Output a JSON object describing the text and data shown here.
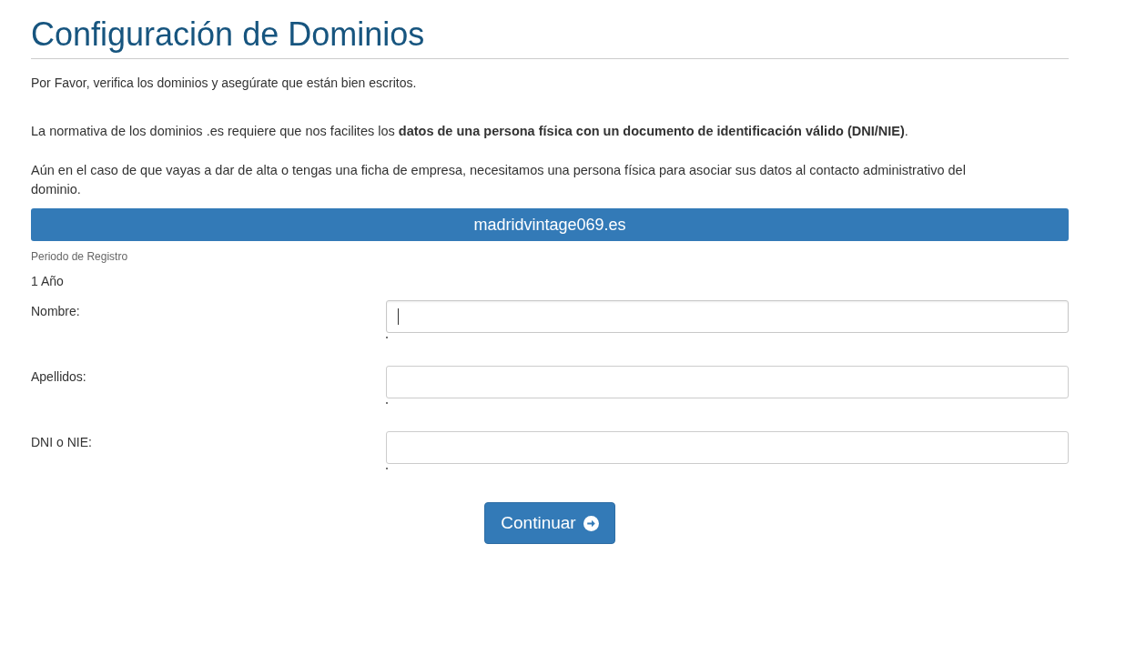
{
  "title": "Configuración de Dominios",
  "intro": "Por Favor, verifica los dominios y asegúrate que están bien escritos.",
  "paragraphs": [
    "La normativa de los dominios .es requiere que nos facilites los **datos de una persona física con un documento de identificación válido (DNI/NIE)**.",
    "Aún en el caso de que vayas a dar de alta o tengas una ficha de empresa, necesitamos una persona física para asociar sus datos al contacto administrativo del dominio."
  ],
  "domain": "madridvintage069.es",
  "period": {
    "label": "Periodo de Registro",
    "value": "1 Año"
  },
  "fields": [
    {
      "label": "Nombre:",
      "focused": true
    },
    {
      "label": "Apellidos:",
      "focused": false
    },
    {
      "label": "DNI o NIE:",
      "focused": false
    }
  ],
  "button": "Continuar"
}
